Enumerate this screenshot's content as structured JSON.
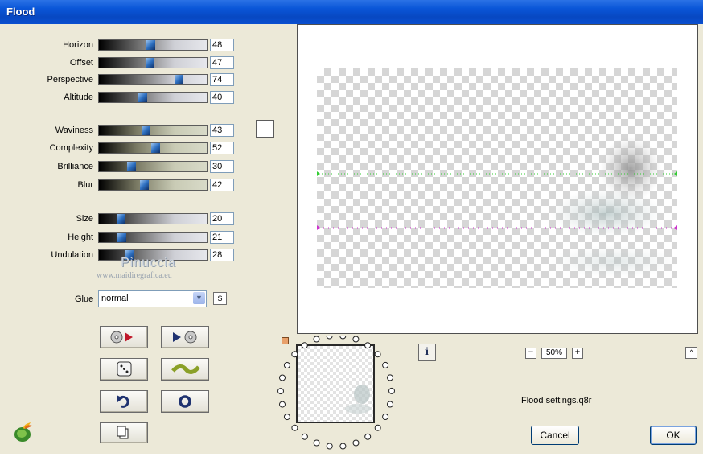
{
  "window": {
    "title": "Flood"
  },
  "sliders": [
    {
      "label": "Horizon",
      "value": "48",
      "level": 48,
      "style": "gray"
    },
    {
      "label": "Offset",
      "value": "47",
      "level": 47,
      "style": "gray"
    },
    {
      "label": "Perspective",
      "value": "74",
      "level": 74,
      "style": "gray"
    },
    {
      "label": "Altitude",
      "value": "40",
      "level": 40,
      "style": "gray"
    },
    {
      "label": "Waviness",
      "value": "43",
      "level": 43,
      "style": "olive"
    },
    {
      "label": "Complexity",
      "value": "52",
      "level": 52,
      "style": "olive"
    },
    {
      "label": "Brilliance",
      "value": "30",
      "level": 30,
      "style": "olive"
    },
    {
      "label": "Blur",
      "value": "42",
      "level": 42,
      "style": "olive"
    },
    {
      "label": "Size",
      "value": "20",
      "level": 20,
      "style": "gray"
    },
    {
      "label": "Height",
      "value": "21",
      "level": 21,
      "style": "gray"
    },
    {
      "label": "Undulation",
      "value": "28",
      "level": 28,
      "style": "gray"
    }
  ],
  "glue": {
    "label": "Glue",
    "value": "normal",
    "s_button": "S"
  },
  "watermark": {
    "name": "Pinuccia",
    "url": "www.maidiregrafica.eu"
  },
  "icons": {
    "load_preset": "disk-arrow-icon",
    "save_preset": "arrow-disk-icon",
    "random": "dice-icon",
    "wave": "wave-icon",
    "undo": "undo-icon",
    "reset": "ring-icon",
    "copy": "copy-icon",
    "info": "info-icon",
    "logo": "flaming-pear-logo"
  },
  "zoom": {
    "value": "50%",
    "minus": "−",
    "plus": "+"
  },
  "info_label": "i",
  "up_label": "^",
  "settings_file": "Flood settings.q8r",
  "buttons": {
    "cancel": "Cancel",
    "ok": "OK"
  },
  "colors": {
    "title_bar": "#0a56d8",
    "horizon_line": "#33cc33",
    "flood_line": "#cc33cc",
    "swatch": "#ffffff"
  }
}
